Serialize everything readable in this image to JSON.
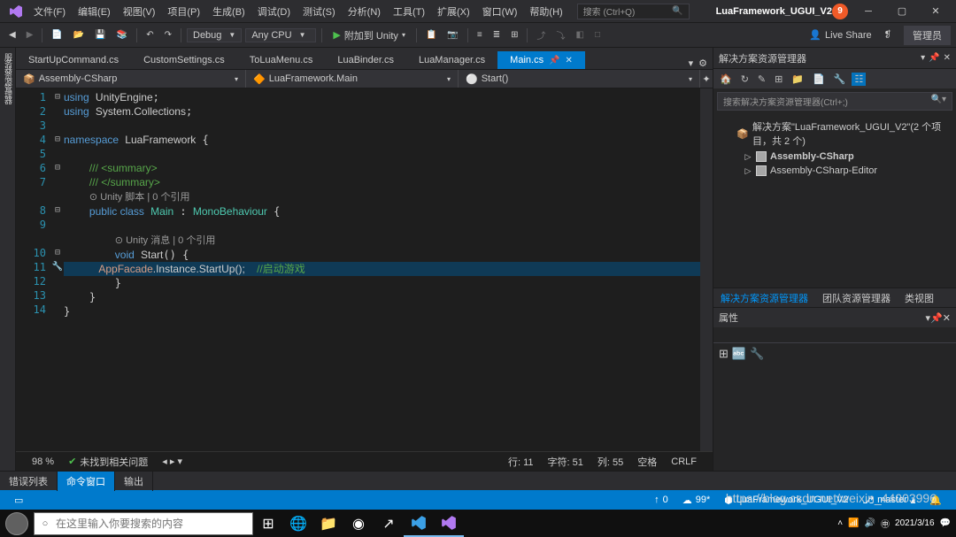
{
  "title": "LuaFramework_UGUI_V2",
  "avatar_num": "9",
  "menu": [
    "文件(F)",
    "编辑(E)",
    "视图(V)",
    "项目(P)",
    "生成(B)",
    "调试(D)",
    "测试(S)",
    "分析(N)",
    "工具(T)",
    "扩展(X)",
    "窗口(W)",
    "帮助(H)"
  ],
  "search_placeholder": "搜索 (Ctrl+Q)",
  "toolbar": {
    "config": "Debug",
    "platform": "Any CPU",
    "run_label": "附加到 Unity",
    "live_share": "Live Share",
    "admin": "管理员"
  },
  "left_tool": "服务器资源管理器",
  "tabs": [
    "StartUpCommand.cs",
    "CustomSettings.cs",
    "ToLuaMenu.cs",
    "LuaBinder.cs",
    "LuaManager.cs",
    "Main.cs"
  ],
  "active_tab": "Main.cs",
  "nav": {
    "scope": "Assembly-CSharp",
    "class": "LuaFramework.Main",
    "member": "Start()"
  },
  "code": {
    "l1": {
      "kw": "using",
      "ns": "UnityEngine"
    },
    "l2": {
      "kw": "using",
      "ns": "System.Collections"
    },
    "l4": {
      "kw": "namespace",
      "ns": "LuaFramework"
    },
    "l6": "/// <summary>",
    "l7": "/// </summary>",
    "ref1": "Unity 脚本 | 0 个引用",
    "l8": {
      "mod": "public class",
      "name": "Main",
      "base": "MonoBehaviour"
    },
    "ref2": "Unity 消息 | 0 个引用",
    "l10": {
      "kw": "void",
      "name": "Start"
    },
    "l11": {
      "call": "AppFacade.Instance.StartUp();",
      "cm": "//启动游戏"
    }
  },
  "status_editor": {
    "pct": "98 %",
    "issues": "未找到相关问题",
    "line": "行: 11",
    "char": "字符: 51",
    "col": "列: 55",
    "ins": "空格",
    "enc": "CRLF"
  },
  "bottom_tabs": [
    "错误列表",
    "命令窗口",
    "输出"
  ],
  "sol": {
    "title": "解决方案资源管理器",
    "search": "搜索解决方案资源管理器(Ctrl+;)",
    "root": "解决方案\"LuaFramework_UGUI_V2\"(2 个项目，共 2 个)",
    "p1": "Assembly-CSharp",
    "p2": "Assembly-CSharp-Editor",
    "tabs": [
      "解决方案资源管理器",
      "团队资源管理器",
      "类视图"
    ]
  },
  "prop": {
    "title": "属性"
  },
  "statusbar": {
    "up": "0",
    "cloud": "99*",
    "proj": "LuaFramework_UGUI_V2",
    "branch": "master"
  },
  "taskbar": {
    "search": "在这里输入你要搜索的内容",
    "time": "2021/3/16"
  },
  "watermark": "https://blog.csdn.net/weixin_44003996"
}
